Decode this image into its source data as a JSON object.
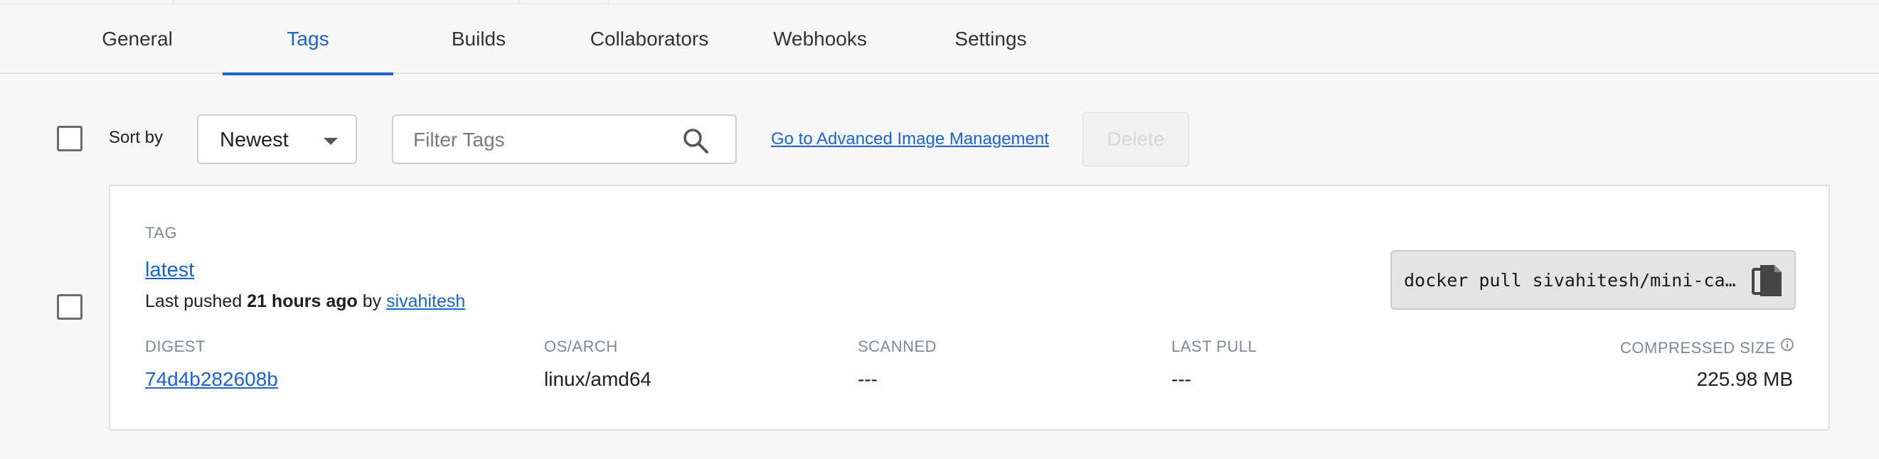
{
  "tabs": [
    {
      "label": "General",
      "active": false
    },
    {
      "label": "Tags",
      "active": true
    },
    {
      "label": "Builds",
      "active": false
    },
    {
      "label": "Collaborators",
      "active": false
    },
    {
      "label": "Webhooks",
      "active": false
    },
    {
      "label": "Settings",
      "active": false
    }
  ],
  "toolbar": {
    "sort_label": "Sort by",
    "sort_value": "Newest",
    "filter_placeholder": "Filter Tags",
    "advanced_link": "Go to Advanced Image Management",
    "delete_label": "Delete"
  },
  "tag_card": {
    "header": "TAG",
    "tag_name": "latest",
    "pushed_prefix": "Last pushed",
    "pushed_time": "21 hours ago",
    "pushed_by": "by",
    "pushed_user": "sivahitesh",
    "pull_command": "docker pull sivahitesh/mini-calculator:latest",
    "columns": {
      "digest_header": "DIGEST",
      "digest_value": "74d4b282608b",
      "osarch_header": "OS/ARCH",
      "osarch_value": "linux/amd64",
      "scanned_header": "SCANNED",
      "scanned_value": "---",
      "lastpull_header": "LAST PULL",
      "lastpull_value": "---",
      "size_header": "COMPRESSED SIZE",
      "size_value": "225.98 MB"
    }
  },
  "colors": {
    "accent": "#1d63c9",
    "background": "#f7f7f7",
    "muted": "#7f8895"
  },
  "icons": {
    "search": "search-icon",
    "copy": "copy-icon",
    "info": "info-icon",
    "dropdown": "chevron-down-icon"
  }
}
